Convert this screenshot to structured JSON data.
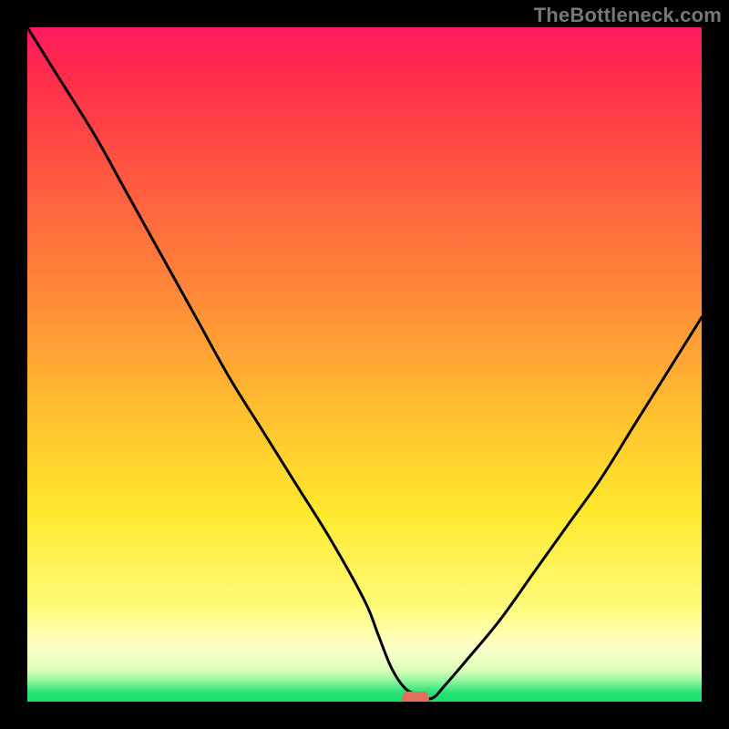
{
  "attribution": {
    "text": "TheBottleneck.com"
  },
  "chart_data": {
    "type": "line",
    "title": "",
    "xlabel": "",
    "ylabel": "",
    "xlim": [
      0,
      100
    ],
    "ylim": [
      0,
      100
    ],
    "grid": false,
    "legend": false,
    "background": {
      "type": "vertical-gradient",
      "stops": [
        {
          "pos": 0,
          "color": "#ff1a5e"
        },
        {
          "pos": 8,
          "color": "#ff2f4a"
        },
        {
          "pos": 22,
          "color": "#ff5840"
        },
        {
          "pos": 40,
          "color": "#ff8a38"
        },
        {
          "pos": 58,
          "color": "#ffc22f"
        },
        {
          "pos": 72,
          "color": "#ffe92e"
        },
        {
          "pos": 86,
          "color": "#fffb7a"
        },
        {
          "pos": 92,
          "color": "#fdffc9"
        },
        {
          "pos": 95.5,
          "color": "#d8ffb7"
        },
        {
          "pos": 97,
          "color": "#8cf59b"
        },
        {
          "pos": 98.5,
          "color": "#2ee37a"
        },
        {
          "pos": 100,
          "color": "#17e06e"
        }
      ]
    },
    "series": [
      {
        "name": "bottleneck-curve",
        "color": "#000000",
        "x": [
          0,
          5,
          10,
          15,
          20,
          25,
          30,
          35,
          40,
          45,
          50,
          52,
          54,
          56,
          58,
          60,
          62,
          65,
          70,
          75,
          80,
          85,
          90,
          95,
          100
        ],
        "y": [
          100,
          92,
          84,
          75,
          66,
          57,
          48,
          40,
          32,
          24,
          15,
          10,
          5,
          2,
          1,
          0.5,
          2.5,
          6,
          12,
          19,
          26,
          33,
          41,
          49,
          57
        ],
        "flat_segment_x": [
          52,
          62
        ]
      }
    ],
    "marker": {
      "name": "optimal-point",
      "x": 57.5,
      "y": 0.5,
      "color": "#e2705d",
      "shape": "rounded-rect"
    }
  }
}
